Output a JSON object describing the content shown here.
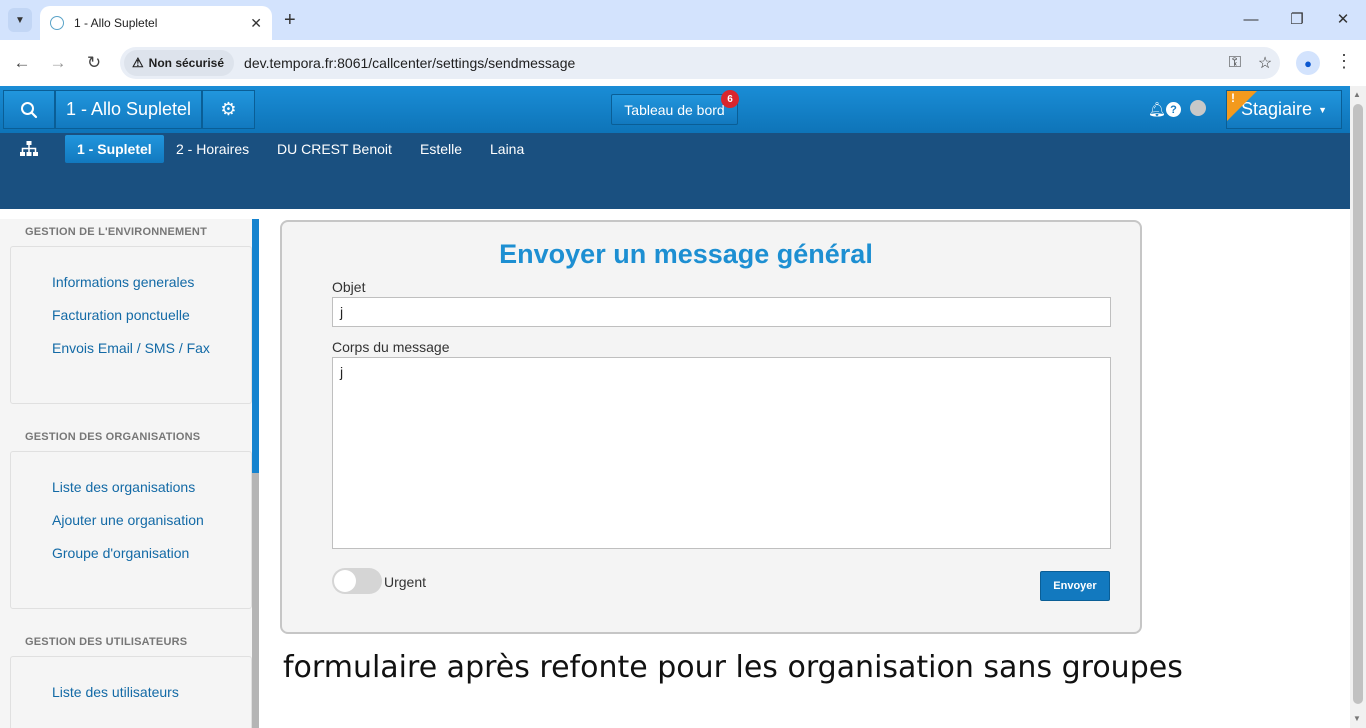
{
  "browser": {
    "tab_title": "1 - Allo Supletel",
    "security_label": "Non sécurisé",
    "url": "dev.tempora.fr:8061/callcenter/settings/sendmessage"
  },
  "header": {
    "org_name": "1 - Allo Supletel",
    "dashboard_label": "Tableau de bord",
    "dashboard_badge": "6",
    "user_label": "Stagiaire",
    "flag_mark": "!"
  },
  "subnav": {
    "tabs": [
      {
        "label": "1 - Supletel",
        "active": true
      },
      {
        "label": "2 - Horaires",
        "active": false
      },
      {
        "label": "DU CREST Benoit",
        "active": false
      },
      {
        "label": "Estelle",
        "active": false
      },
      {
        "label": "Laina",
        "active": false
      }
    ]
  },
  "sidebar": {
    "sections": [
      {
        "heading": "GESTION DE L'ENVIRONNEMENT",
        "links": [
          "Informations generales",
          "Facturation ponctuelle",
          "Envois Email / SMS / Fax"
        ]
      },
      {
        "heading": "GESTION DES ORGANISATIONS",
        "links": [
          "Liste des organisations",
          "Ajouter une organisation",
          "Groupe d'organisation"
        ]
      },
      {
        "heading": "GESTION DES UTILISATEURS",
        "links": [
          "Liste des utilisateurs"
        ]
      }
    ]
  },
  "form": {
    "title": "Envoyer un message général",
    "subject_label": "Objet",
    "subject_value": "j",
    "body_label": "Corps du message",
    "body_value": "j",
    "urgent_label": "Urgent",
    "urgent_on": false,
    "submit_label": "Envoyer"
  },
  "caption": "formulaire après refonte pour les organisation sans groupes",
  "colors": {
    "header_blue": "#1a8dd6",
    "subnav_blue": "#1a5080",
    "title_blue": "#1d8fd2",
    "link_blue": "#136aa6",
    "badge_red": "#d9262d",
    "flag_orange": "#f39a1d"
  }
}
